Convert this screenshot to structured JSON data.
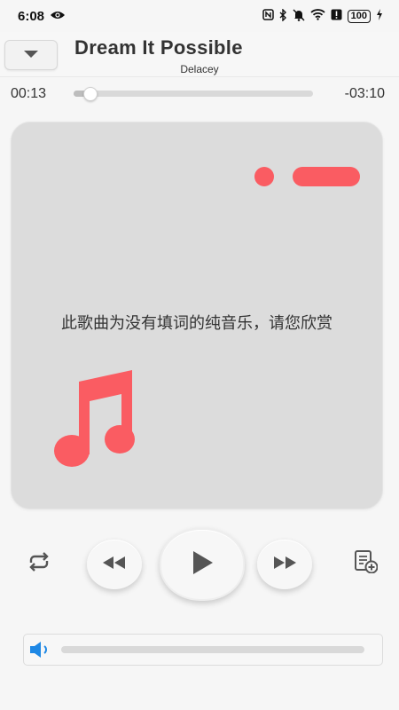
{
  "status_bar": {
    "time": "6:08",
    "battery": "100",
    "icons": [
      "eye-icon",
      "nfc-icon",
      "bluetooth-icon",
      "mute-icon",
      "wifi-icon",
      "alert-icon",
      "battery-icon",
      "charging-icon"
    ]
  },
  "header": {
    "collapse_icon": "chevron-down-icon",
    "title": "Dream It Possible",
    "artist": "Delacey"
  },
  "progress": {
    "elapsed": "00:13",
    "remaining": "-03:10",
    "fraction": 0.065
  },
  "artwork": {
    "message": "此歌曲为没有填词的纯音乐，请您欣赏",
    "accent_color": "#fa5c62",
    "icon": "music-note-icon"
  },
  "controls": {
    "repeat_icon": "repeat-icon",
    "previous_icon": "rewind-icon",
    "play_icon": "play-icon",
    "next_icon": "fast-forward-icon",
    "playlist_add_icon": "playlist-add-icon"
  },
  "volume": {
    "icon": "speaker-icon",
    "level": 0.0,
    "icon_color": "#1e88e5"
  }
}
